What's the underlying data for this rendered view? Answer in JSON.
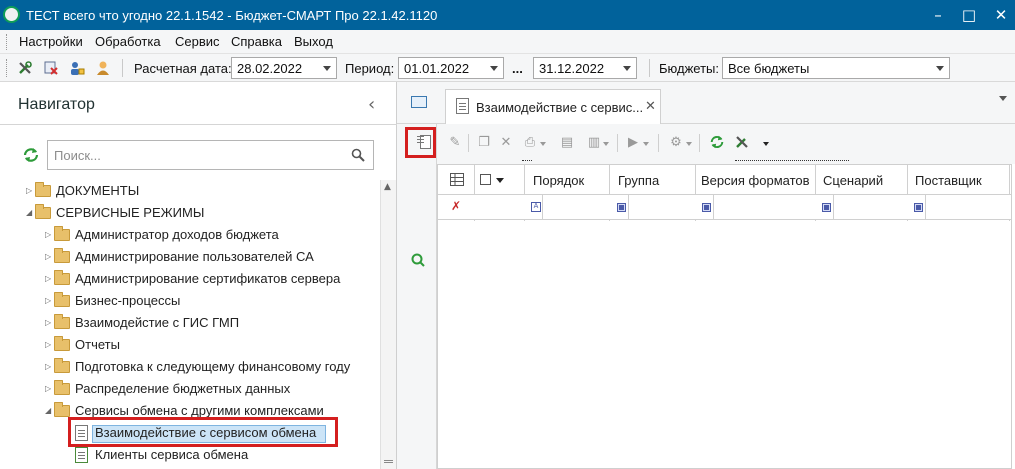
{
  "window": {
    "title": "ТЕСТ всего что угодно 22.1.1542 - Бюджет-СМАРТ Про 22.1.42.1120"
  },
  "menu": [
    "Настройки",
    "Обработка",
    "Сервис",
    "Справка",
    "Выход"
  ],
  "toolbar": {
    "calc_date_label": "Расчетная дата:",
    "calc_date_value": "28.02.2022",
    "period_label": "Период:",
    "period_from": "01.01.2022",
    "period_sep": "...",
    "period_to": "31.12.2022",
    "budgets_label": "Бюджеты:",
    "budgets_value": "Все бюджеты"
  },
  "navigator": {
    "title": "Навигатор",
    "search_placeholder": "Поиск...",
    "tree": [
      "ДОКУМЕНТЫ",
      "СЕРВИСНЫЕ РЕЖИМЫ",
      "Администратор доходов бюджета",
      "Администрирование пользователей СА",
      "Администрирование сертификатов сервера",
      "Бизнес-процессы",
      "Взаимодейстие с ГИС ГМП",
      "Отчеты",
      "Подготовка к следующему финансовому году",
      "Распределение бюджетных данных",
      "Сервисы обмена с другими комплексами",
      "Взаимодействие с сервисом обмена",
      "Клиенты сервиса обмена"
    ]
  },
  "tab": {
    "label": "Взаимодействие с сервис..."
  },
  "grid": {
    "columns": [
      "Порядок",
      "Группа",
      "Версия форматов",
      "Сценарий",
      "Поставщик"
    ]
  },
  "colors": {
    "titlebar": "#01629b",
    "highlight_box": "#d41f1f",
    "selection": "#cce4f7"
  }
}
